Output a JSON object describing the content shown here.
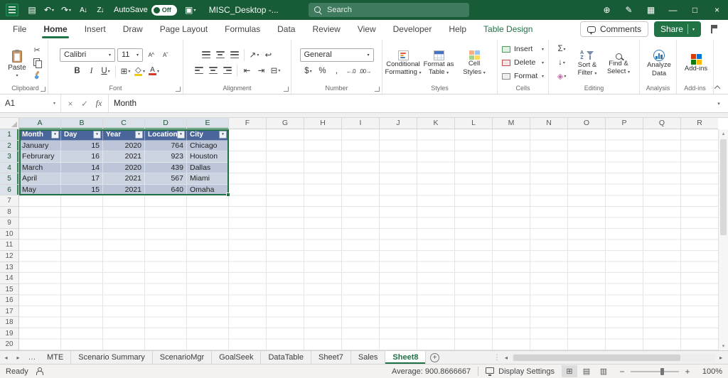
{
  "titlebar": {
    "title": "MISC_Desktop -...",
    "autosave": "AutoSave",
    "autosave_state": "Off",
    "search_placeholder": "Search"
  },
  "icons": {
    "dropdown": "▾",
    "workbook": "▤",
    "undo": "↶",
    "redo": "↷",
    "sort_asc": "A↓",
    "sort_desc": "Z↓",
    "save": "▣",
    "globe": "⊕",
    "pencil": "✎",
    "apps": "▦",
    "minimize": "—",
    "maximize": "□",
    "close": "×",
    "cut": "✂",
    "bold": "B",
    "italic": "I",
    "underline": "U",
    "font_bigger": "A^",
    "font_smaller": "Aˇ",
    "borders": "⊞",
    "fill": "◇",
    "font_color": "A",
    "orientation": "↗",
    "wrap": "↩",
    "mer ge": "⊟",
    "merge": "⊟",
    "indent_dec": "⇤",
    "indent_inc": "⇥",
    "dollar": "$",
    "percent": "%",
    "comma": ",",
    "dec_inc": "←.0",
    "dec_dec": ".00→",
    "sigma": "Σ",
    "fill_down": "↓",
    "clear": "◈",
    "cancel": "×",
    "enter": "✓",
    "fx": "fx",
    "prev": "◂",
    "next": "▸",
    "up": "▴",
    "down": "▾",
    "overflow": "…",
    "add": "+",
    "dots": "⋮",
    "view_normal": "⊞",
    "view_layout": "▤",
    "view_break": "▥",
    "zoom_out": "−",
    "zoom_in": "+"
  },
  "ribbon": {
    "tabs": [
      "File",
      "Home",
      "Insert",
      "Draw",
      "Page Layout",
      "Formulas",
      "Data",
      "Review",
      "View",
      "Developer",
      "Help",
      "Table Design"
    ],
    "active_tab": "Home",
    "contextual_tab": "Table Design",
    "comments_label": "Comments",
    "share_label": "Share",
    "font_name": "Calibri",
    "font_size": "11",
    "number_format": "General",
    "paste": "Paste",
    "conditional_formatting": [
      "Conditional",
      "Formatting"
    ],
    "format_as_table": [
      "Format as",
      "Table"
    ],
    "cell_styles": [
      "Cell",
      "Styles"
    ],
    "insert": "Insert",
    "delete": "Delete",
    "format": "Format",
    "sort_filter": [
      "Sort &",
      "Filter"
    ],
    "find_select": [
      "Find &",
      "Select"
    ],
    "analyze_data": [
      "Analyze",
      "Data"
    ],
    "addins_label": "Add-ins",
    "group_labels": {
      "clipboard": "Clipboard",
      "font": "Font",
      "alignment": "Alignment",
      "number": "Number",
      "styles": "Styles",
      "cells": "Cells",
      "editing": "Editing",
      "analysis": "Analysis",
      "addins": "Add-ins"
    }
  },
  "formula_bar": {
    "name_box": "A1",
    "formula": "Month"
  },
  "grid": {
    "columns": [
      "A",
      "B",
      "C",
      "D",
      "E",
      "F",
      "G",
      "H",
      "I",
      "J",
      "K",
      "L",
      "M",
      "N",
      "O",
      "P",
      "Q",
      "R"
    ],
    "rows": [
      1,
      2,
      3,
      4,
      5,
      6,
      7,
      8,
      9,
      10,
      11,
      12,
      13,
      14,
      15,
      16,
      17,
      18,
      19,
      20
    ],
    "selected_columns": [
      "A",
      "B",
      "C",
      "D",
      "E"
    ],
    "selected_rows": [
      1,
      2,
      3,
      4,
      5,
      6
    ]
  },
  "table": {
    "headers": [
      "Month",
      "Day",
      "Year",
      "Location",
      "City"
    ],
    "rows": [
      [
        "January",
        15,
        2020,
        764,
        "Chicago"
      ],
      [
        "Februrary",
        16,
        2021,
        923,
        "Houston"
      ],
      [
        "March",
        14,
        2020,
        439,
        "Dallas"
      ],
      [
        "April",
        17,
        2021,
        567,
        "Miami"
      ],
      [
        "May",
        15,
        2021,
        640,
        "Omaha"
      ]
    ],
    "numeric_columns": [
      1,
      2,
      3
    ]
  },
  "sheet_tabs": {
    "tabs": [
      "MTE",
      "Scenario Summary",
      "ScenarioMgr",
      "GoalSeek",
      "DataTable",
      "Sheet7",
      "Sales",
      "Sheet8"
    ],
    "active": "Sheet8"
  },
  "status": {
    "ready": "Ready",
    "average": "Average: 900.8666667",
    "display_settings": "Display Settings",
    "zoom": "100%"
  },
  "colors": {
    "accent": "#217346",
    "titlebar": "#185C37",
    "table_header": "#4A659A",
    "band_dark": "#BCC6D8",
    "band_light": "#CBD3E1"
  }
}
